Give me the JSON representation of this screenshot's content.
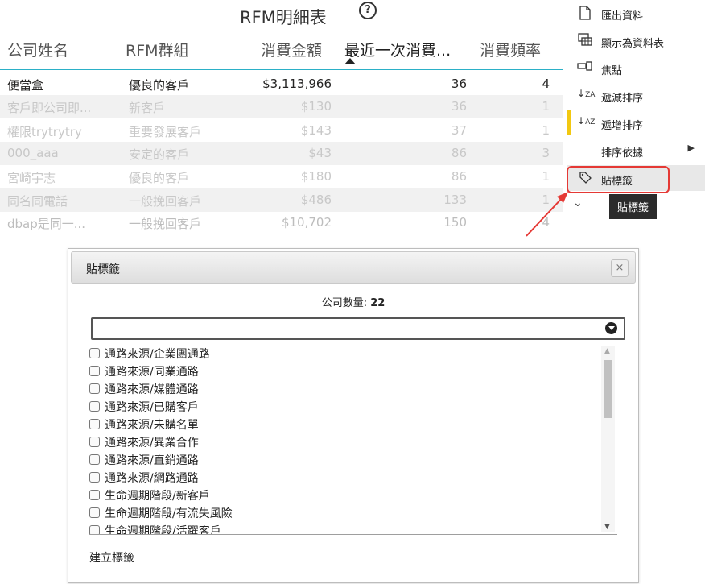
{
  "visual": {
    "title": "RFM明細表",
    "help_icon": "?",
    "columns": [
      "公司姓名",
      "RFM群組",
      "消費金額",
      "最近一次消費...",
      "消費頻率"
    ],
    "rows": [
      [
        "便當盒",
        "優良的客戶",
        "$3,113,966",
        "36",
        "4"
      ],
      [
        "客戶即公司即...",
        "新客戶",
        "$130",
        "36",
        "1"
      ],
      [
        "權限trytrytry",
        "重要發展客戶",
        "$143",
        "37",
        "1"
      ],
      [
        "000_aaa",
        "安定的客戶",
        "$43",
        "86",
        "3"
      ],
      [
        "宮崎宇志",
        "優良的客戶",
        "$180",
        "86",
        "1"
      ],
      [
        "同名同電話",
        "一般挽回客戶",
        "$486",
        "133",
        "1"
      ],
      [
        "dbap是同一...",
        "一般挽回客戶",
        "$10,702",
        "150",
        "4"
      ]
    ]
  },
  "menu": {
    "items": [
      {
        "label": "匯出資料",
        "icon": "export-icon"
      },
      {
        "label": "顯示為資料表",
        "icon": "table-icon"
      },
      {
        "label": "焦點",
        "icon": "focus-icon"
      },
      {
        "label": "遞減排序",
        "icon": "sort-desc-icon"
      },
      {
        "label": "遞增排序",
        "icon": "sort-asc-icon"
      },
      {
        "label": "排序依據",
        "icon": ""
      },
      {
        "label": "貼標籤",
        "icon": "tag-icon"
      }
    ],
    "tooltip": "貼標籤"
  },
  "dialog": {
    "title": "貼標籤",
    "close": "×",
    "count_label": "公司數量:",
    "count_value": "22",
    "filter_value": "",
    "options": [
      "通路來源/企業團通路",
      "通路來源/同業通路",
      "通路來源/媒體通路",
      "通路來源/已購客戶",
      "通路來源/未購名單",
      "通路來源/異業合作",
      "通路來源/直銷通路",
      "通路來源/網路通路",
      "生命週期階段/新客戶",
      "生命週期階段/有流失風險",
      "生命週期階段/活躍客戶"
    ],
    "create_label": "建立標籤"
  }
}
